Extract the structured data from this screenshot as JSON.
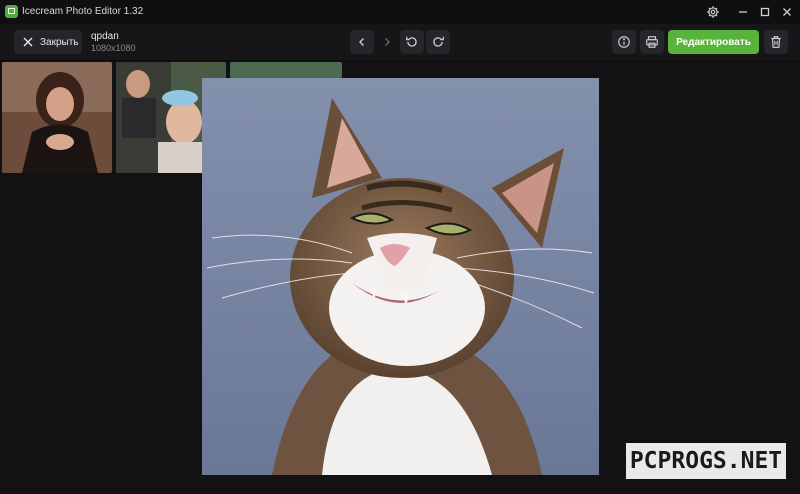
{
  "window": {
    "title": "Icecream Photo Editor 1.32"
  },
  "toolbar": {
    "close_label": "Закрыть",
    "file_name": "qpdan",
    "file_dimensions": "1080x1080",
    "edit_label": "Редактировать"
  },
  "colors": {
    "accent": "#58b33b",
    "background": "#121214",
    "toolbar": "#161618"
  },
  "icons": [
    "settings-gear-icon",
    "minimize-icon",
    "maximize-icon",
    "close-window-icon",
    "close-x-icon",
    "chevron-left-icon",
    "chevron-right-icon",
    "rotate-left-icon",
    "rotate-right-icon",
    "info-icon",
    "print-icon",
    "trash-icon"
  ],
  "watermark": {
    "text": "PCPROGS.NET"
  }
}
